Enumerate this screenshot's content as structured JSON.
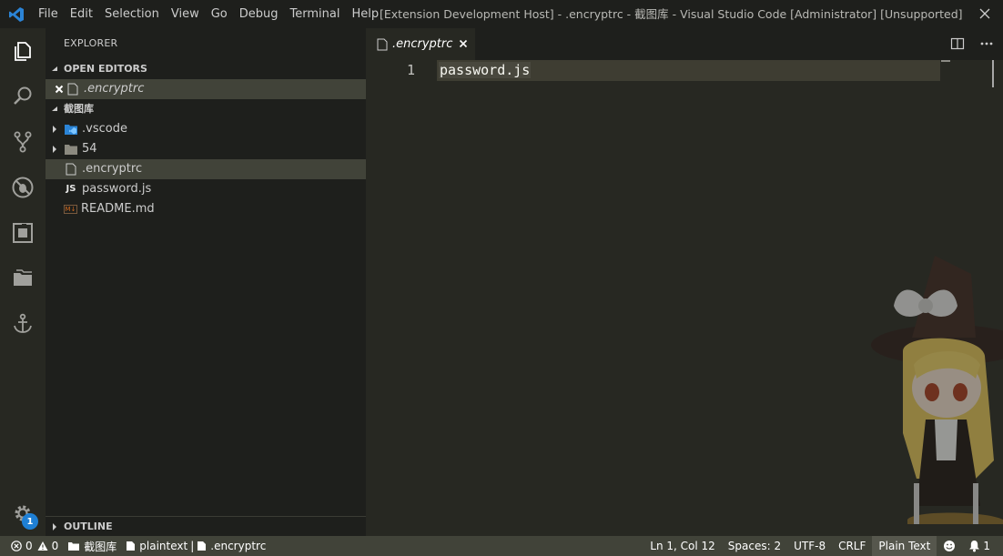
{
  "titlebar": {
    "menu": [
      "File",
      "Edit",
      "Selection",
      "View",
      "Go",
      "Debug",
      "Terminal",
      "Help"
    ],
    "window_title": "[Extension Development Host] - .encryptrc - 截图库 - Visual Studio Code [Administrator] [Unsupported]"
  },
  "activitybar": {
    "items": [
      "files-icon",
      "search-icon",
      "source-control-icon",
      "debug-icon",
      "extensions-icon",
      "folder-icon",
      "anchor-icon"
    ],
    "settings_badge": "1"
  },
  "sidebar": {
    "title": "EXPLORER",
    "open_editors": {
      "header": "OPEN EDITORS",
      "items": [
        {
          "name": ".encryptrc"
        }
      ]
    },
    "workspace": {
      "header": "截图库",
      "items": [
        {
          "name": ".vscode",
          "type": "folder"
        },
        {
          "name": "54",
          "type": "folder"
        },
        {
          "name": ".encryptrc",
          "type": "file",
          "selected": true
        },
        {
          "name": "password.js",
          "type": "js",
          "icon_label": "JS"
        },
        {
          "name": "README.md",
          "type": "md",
          "icon_label": "M↓"
        }
      ]
    },
    "outline_header": "OUTLINE"
  },
  "editor": {
    "tab_label": ".encryptrc",
    "line_numbers": [
      "1"
    ],
    "lines": [
      "password.js"
    ]
  },
  "statusbar": {
    "errors": "0",
    "warnings": "0",
    "folder": "截图库",
    "language_id": "plaintext",
    "separator": "|",
    "file": ".encryptrc",
    "position": "Ln 1, Col 12",
    "spaces": "Spaces: 2",
    "encoding": "UTF-8",
    "eol": "CRLF",
    "language": "Plain Text",
    "notifications": "1"
  },
  "colors": {
    "accent": "#1e7fd4",
    "status_bar": "#414339",
    "sidebar": "#1e1f1c",
    "editor": "#272822"
  }
}
